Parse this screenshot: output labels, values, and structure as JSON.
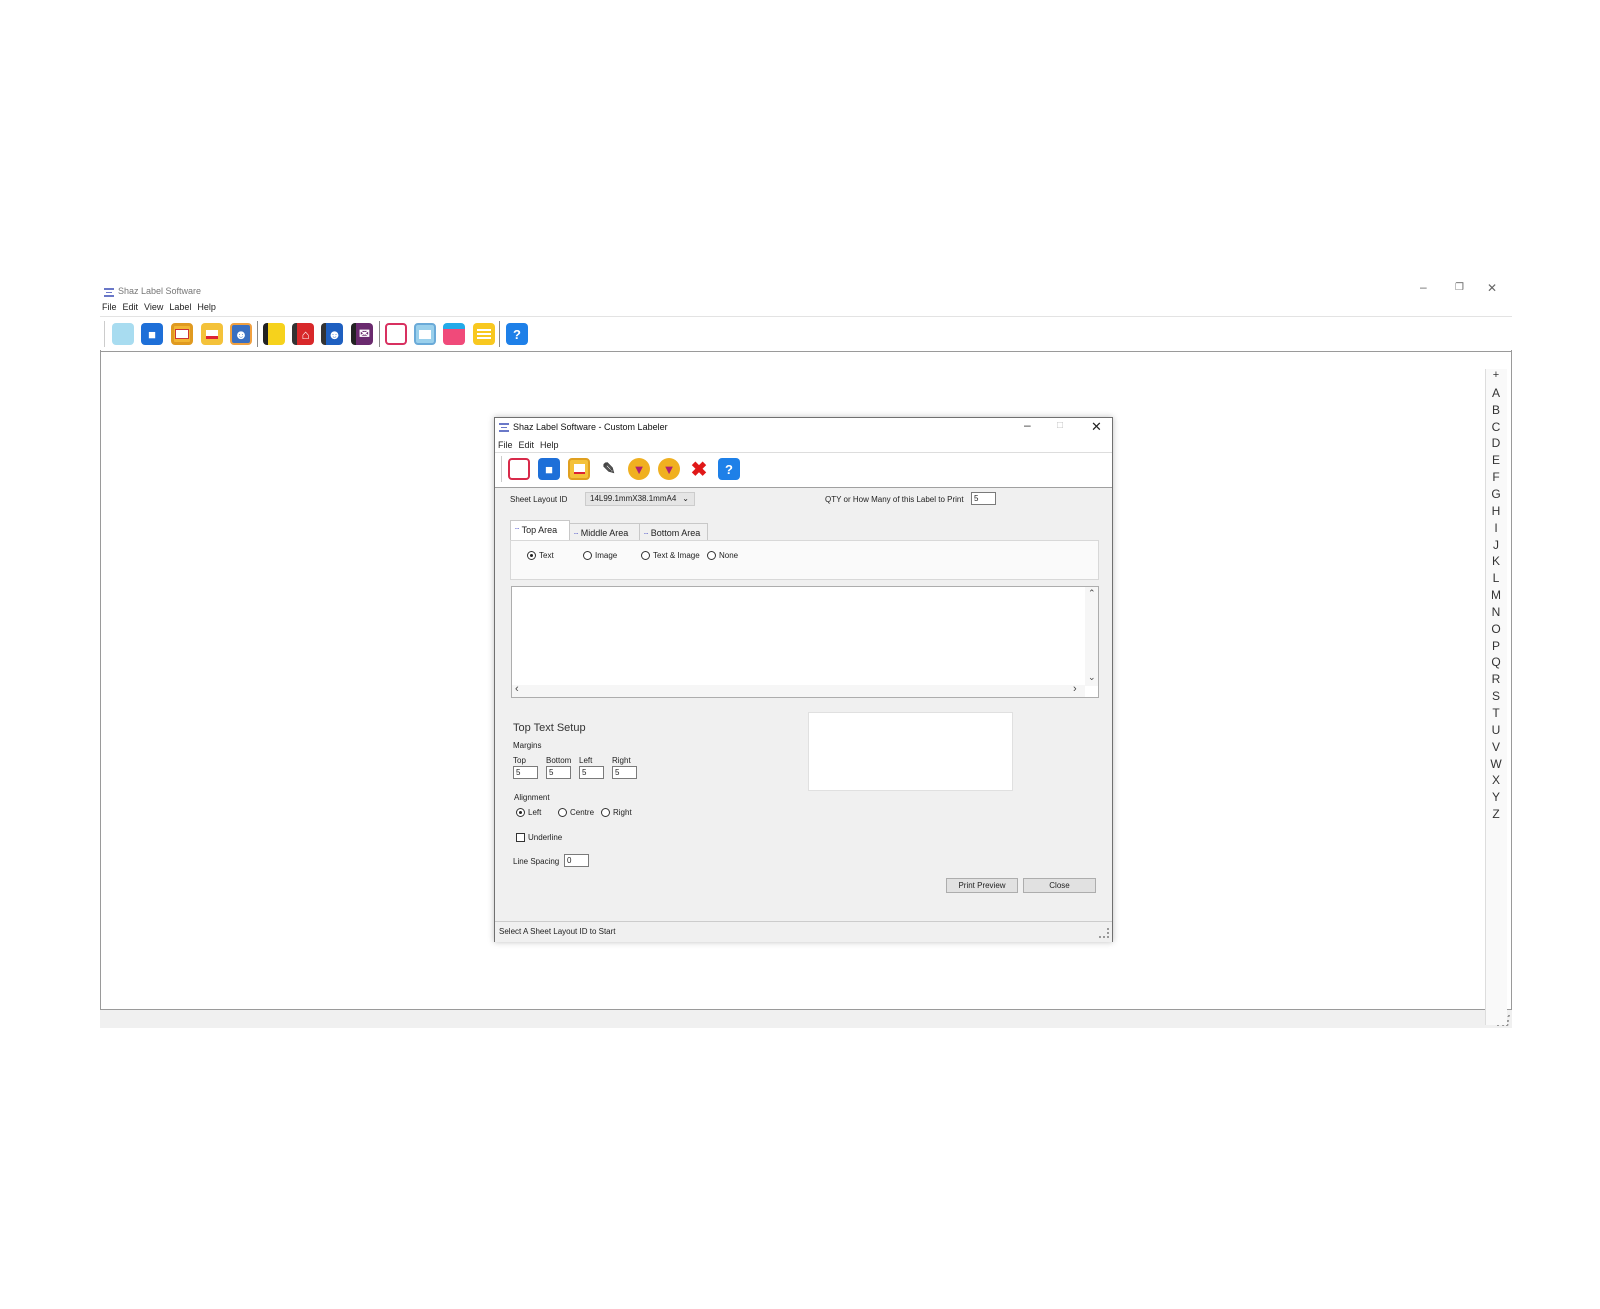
{
  "app": {
    "title": "Shaz Label Software",
    "menu": [
      "File",
      "Edit",
      "View",
      "Label",
      "Help"
    ],
    "window_controls": [
      "minimize-icon",
      "restore-icon",
      "close-icon"
    ],
    "toolbar_icons": [
      "new-label-icon",
      "label-layout-icon",
      "image-label-icon",
      "print-label-icon",
      "people-label-icon",
      "address-book-icon",
      "home-label-icon",
      "contact-card-icon",
      "envelope-label-icon",
      "blank-label-icon",
      "sheet-label-icon",
      "banner-label-icon",
      "notes-label-icon",
      "help-icon"
    ],
    "alphabet": [
      "+",
      "A",
      "B",
      "C",
      "D",
      "E",
      "F",
      "G",
      "H",
      "I",
      "J",
      "K",
      "L",
      "M",
      "N",
      "O",
      "P",
      "Q",
      "R",
      "S",
      "T",
      "U",
      "V",
      "W",
      "X",
      "Y",
      "Z"
    ]
  },
  "dialog": {
    "title": "Shaz Label Software - Custom Labeler",
    "menu": [
      "File",
      "Edit",
      "Help"
    ],
    "toolbar_icons": [
      "new-icon",
      "layout-icon",
      "print-icon",
      "edit-pen-icon",
      "design-icon",
      "design-alt-icon",
      "delete-icon",
      "help-icon"
    ],
    "sheet_layout_label": "Sheet Layout ID",
    "sheet_layout_value": "14L99.1mmX38.1mmA4",
    "qty_label": "QTY or How Many of this Label to Print",
    "qty_value": "5",
    "tabs": [
      "Top Area",
      "Middle Area",
      "Bottom Area"
    ],
    "content_options": [
      "Text",
      "Image",
      "Text & Image",
      "None"
    ],
    "content_selected": "Text",
    "setup_title": "Top Text Setup",
    "margins_label": "Margins",
    "margin_labels": [
      "Top",
      "Bottom",
      "Left",
      "Right"
    ],
    "margin_values": [
      "5",
      "5",
      "5",
      "5"
    ],
    "alignment_label": "Alignment",
    "alignment_options": [
      "Left",
      "Centre",
      "Right"
    ],
    "alignment_selected": "Left",
    "underline_label": "Underline",
    "underline_checked": false,
    "line_spacing_label": "Line Spacing",
    "line_spacing_value": "0",
    "print_preview_label": "Print Preview",
    "close_label": "Close",
    "status_text": "Select A Sheet Layout ID to Start"
  }
}
